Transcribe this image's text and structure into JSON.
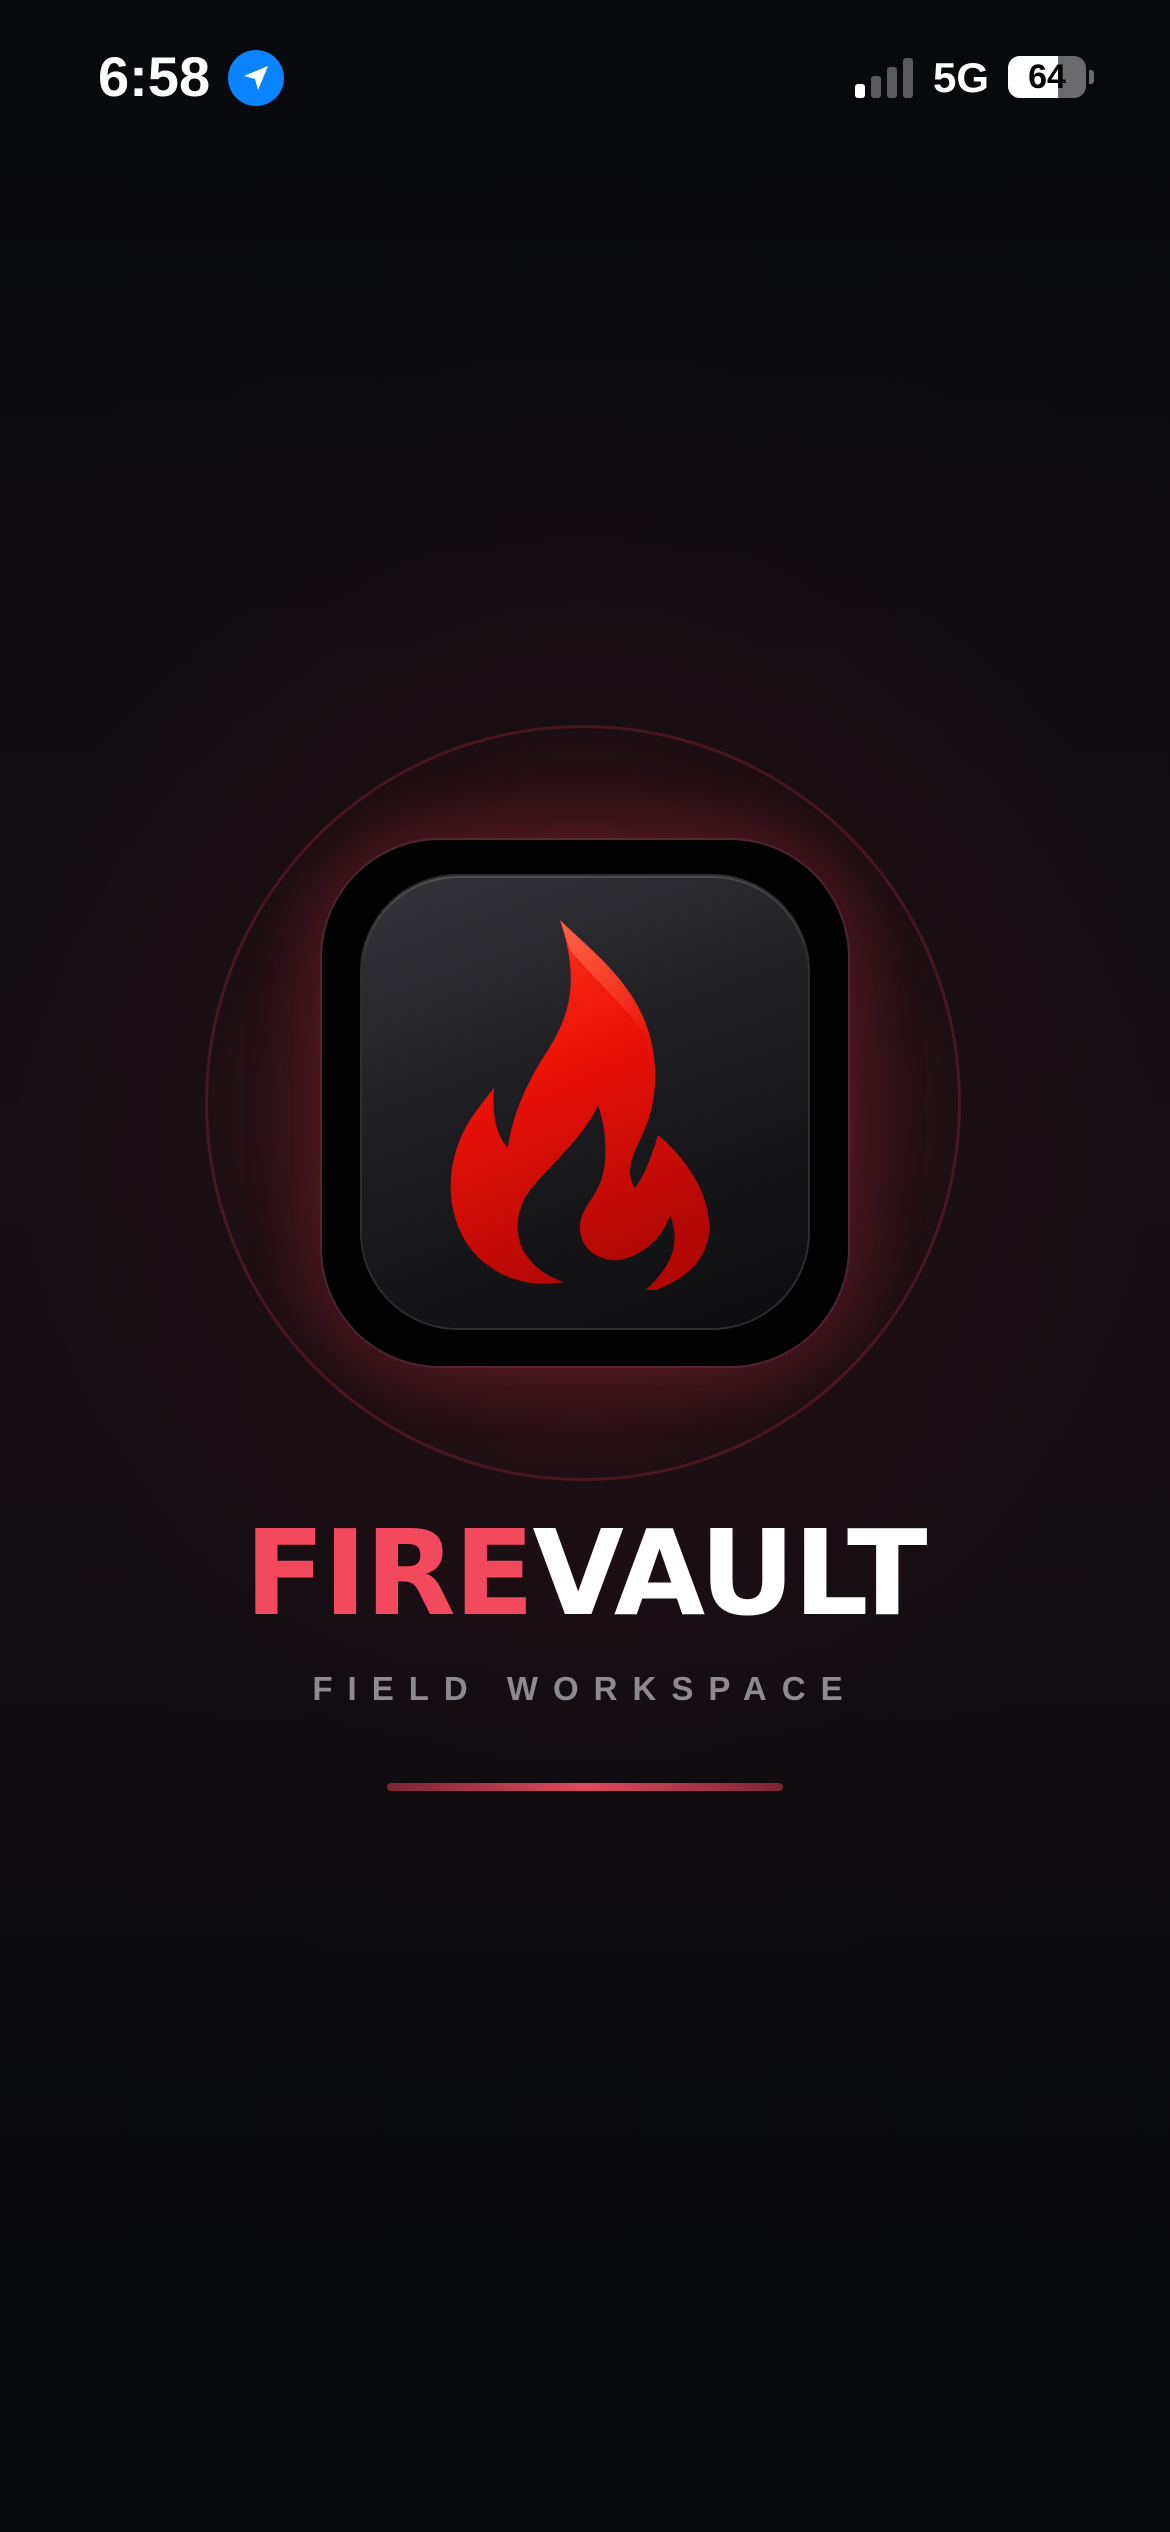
{
  "status_bar": {
    "time": "6:58",
    "network": "5G",
    "battery_level": "64",
    "battery_fraction": 0.64,
    "signal_bars_active": 1,
    "signal_bars_total": 4,
    "location_icon": "location-arrow-icon",
    "location_color": "#0a84ff"
  },
  "splash": {
    "app_icon": "flame-icon",
    "title_part1": "FIRE",
    "title_part2": "VAULT",
    "subtitle": "FIELD WORKSPACE",
    "loading_progress": 1.0
  },
  "colors": {
    "accent": "#f3495f",
    "background": "#07090d",
    "subtitle": "#8d8b91",
    "flame": "#e3100c"
  }
}
